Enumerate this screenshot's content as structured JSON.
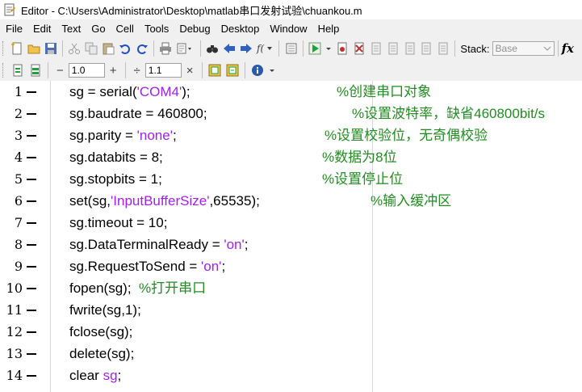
{
  "window": {
    "title": "Editor - C:\\Users\\Administrator\\Desktop\\matlab串口发射试验\\chuankou.m"
  },
  "menu": [
    "File",
    "Edit",
    "Text",
    "Go",
    "Cell",
    "Tools",
    "Debug",
    "Desktop",
    "Window",
    "Help"
  ],
  "toolbar": {
    "icons": [
      "new-file-icon",
      "open-folder-icon",
      "save-icon",
      "cut-icon",
      "copy-icon",
      "paste-icon",
      "undo-icon",
      "redo-icon",
      "print-icon",
      "find-icon",
      "back-icon",
      "forward-icon",
      "function-browser-icon",
      "run-icon",
      "run-dropdown-icon",
      "set-breakpoint-icon",
      "clear-breakpoint-icon",
      "step-icon",
      "step-in-icon",
      "step-out-icon",
      "continue-icon",
      "exit-debug-icon"
    ],
    "stack_label": "Stack:",
    "stack_value": "Base",
    "fx_label": "fx"
  },
  "cell_toolbar": {
    "minus1": "−",
    "field1": "1.0",
    "plus1": "+",
    "div": "÷",
    "field2": "1.1",
    "times": "×"
  },
  "code": {
    "lines": [
      {
        "num": "1",
        "pre": "sg = serial(",
        "str": "'COM4'",
        "post": ");",
        "comment": "%创建串口对象"
      },
      {
        "num": "2",
        "pre": "sg.baudrate = 460800;",
        "str": "",
        "post": "",
        "comment": "%设置波特率，缺省460800bit/s"
      },
      {
        "num": "3",
        "pre": "sg.parity = ",
        "str": "'none'",
        "post": ";",
        "comment": "%设置校验位，无奇偶校验"
      },
      {
        "num": "4",
        "pre": "sg.databits = 8;",
        "str": "",
        "post": "",
        "comment": "%数据为8位"
      },
      {
        "num": "5",
        "pre": "sg.stopbits = 1;",
        "str": "",
        "post": "",
        "comment": "%设置停止位"
      },
      {
        "num": "6",
        "pre": "set(sg,",
        "str": "'InputBufferSize'",
        "post": ",65535);",
        "comment": "%输入缓冲区"
      },
      {
        "num": "7",
        "pre": "sg.timeout = 10;",
        "str": "",
        "post": "",
        "comment": ""
      },
      {
        "num": "8",
        "pre": "sg.DataTerminalReady = ",
        "str": "'on'",
        "post": ";",
        "comment": ""
      },
      {
        "num": "9",
        "pre": "sg.RequestToSend = ",
        "str": "'on'",
        "post": ";",
        "comment": ""
      },
      {
        "num": "10",
        "pre": "fopen(sg);  ",
        "str": "",
        "post": "",
        "comment": "%打开串口"
      },
      {
        "num": "11",
        "pre": "fwrite(sg,1);",
        "str": "",
        "post": "",
        "comment": ""
      },
      {
        "num": "12",
        "pre": "fclose(sg);",
        "str": "",
        "post": "",
        "comment": ""
      },
      {
        "num": "13",
        "pre": "delete(sg);",
        "str": "",
        "post": "",
        "comment": ""
      },
      {
        "num": "14",
        "pre": "clear ",
        "str": "sg",
        "post": ";",
        "comment": ""
      }
    ]
  },
  "colors": {
    "string": "#a020f0",
    "comment": "#228b22",
    "keyword": "#0000ff"
  }
}
